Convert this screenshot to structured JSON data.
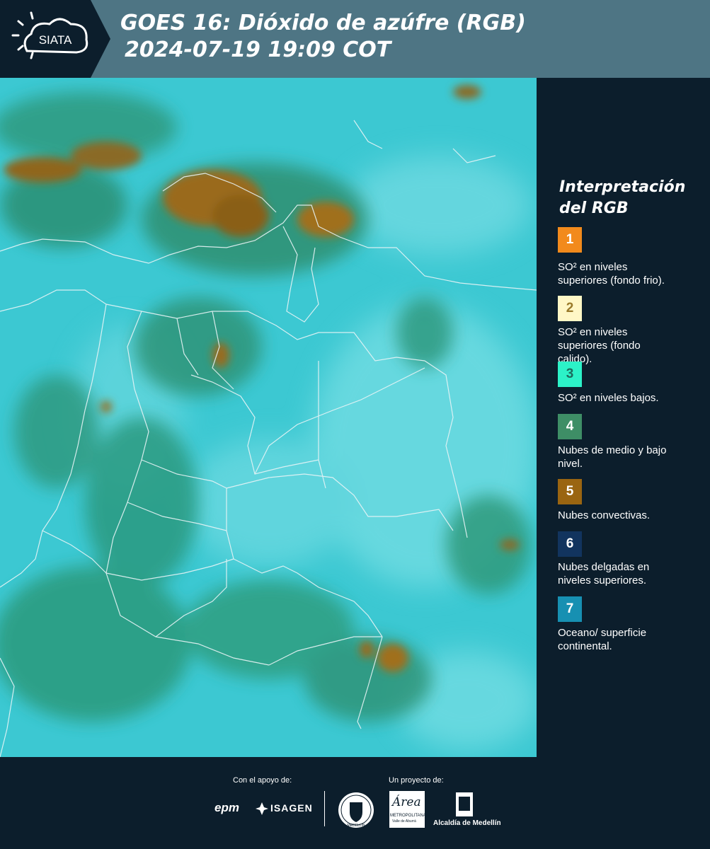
{
  "header": {
    "logo_text": "SIATA",
    "title_line1": "GOES 16: Dióxido de azúfre (RGB)",
    "title_line2": "2024-07-19 19:09 COT"
  },
  "legend": {
    "title_line1": "Interpretación",
    "title_line2": "del RGB",
    "items": [
      {
        "number": "1",
        "color": "#f28a1c",
        "number_color": "#ffffff",
        "text_line1": "SO² en niveles",
        "text_line2": "superiores (fondo frio)."
      },
      {
        "number": "2",
        "color": "#fff7c6",
        "number_color": "#9a7a2a",
        "text_line1": "SO² en niveles",
        "text_line2": "superiores (fondo",
        "text_line3": "calido)."
      },
      {
        "number": "3",
        "color": "#2cf2c8",
        "number_color": "#1c6a5c",
        "text_line1": "SO² en niveles bajos."
      },
      {
        "number": "4",
        "color": "#3e8e66",
        "number_color": "#ffffff",
        "text_line1": "Nubes de medio y bajo",
        "text_line2": "nivel."
      },
      {
        "number": "5",
        "color": "#9a6511",
        "number_color": "#ffffff",
        "text_line1": "Nubes convectivas."
      },
      {
        "number": "6",
        "color": "#12345e",
        "number_color": "#ffffff",
        "text_line1": "Nubes delgadas en",
        "text_line2": "niveles superiores."
      },
      {
        "number": "7",
        "color": "#1790b2",
        "number_color": "#ffffff",
        "text_line1": "Oceano/ superficie",
        "text_line2": "continental."
      }
    ]
  },
  "footer": {
    "support_label": "Con el apoyo de:",
    "project_label": "Un proyecto de:",
    "logo_epm": "epm",
    "logo_isagen": "ISAGEN",
    "logo_area_line1": "Área",
    "logo_area_line2": "METROPOLITANA",
    "logo_area_line3": "Valle de Aburrá",
    "logo_alcaldia": "Alcaldía de Medellín",
    "logo_seal_text": "MEDELLÍN"
  },
  "colors": {
    "header_bg": "#4e7584",
    "dark_bg": "#0c1e2c",
    "map_base": "#35c5cf",
    "convective": "#9a6511",
    "mid_low_cloud": "#3e8e66"
  }
}
